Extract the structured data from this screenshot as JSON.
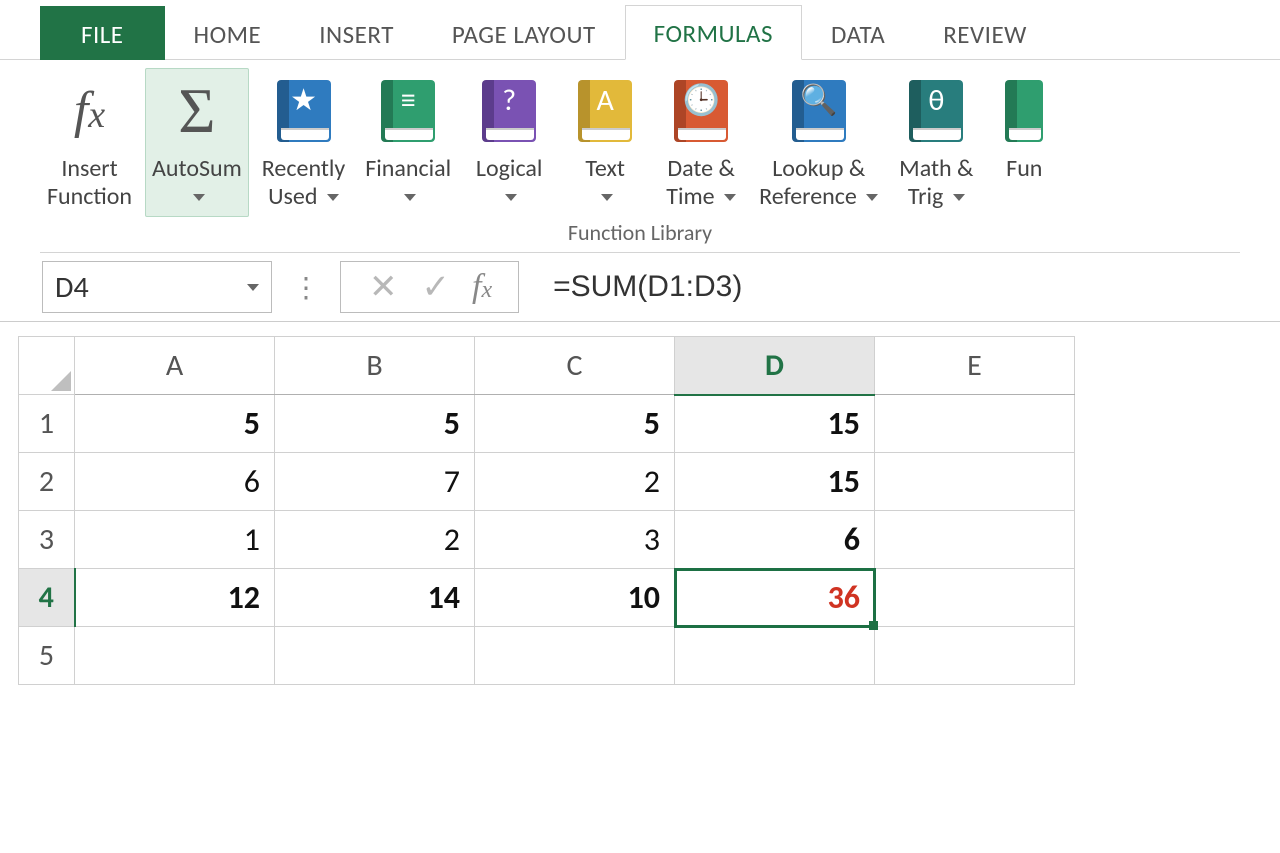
{
  "tabs": {
    "file": "FILE",
    "home": "HOME",
    "insert": "INSERT",
    "page_layout": "PAGE LAYOUT",
    "formulas": "FORMULAS",
    "data": "DATA",
    "review": "REVIEW"
  },
  "ribbon": {
    "insert_function": "Insert\nFunction",
    "autosum": "AutoSum",
    "recently_used": "Recently\nUsed",
    "financial": "Financial",
    "logical": "Logical",
    "text": "Text",
    "date_time": "Date &\nTime",
    "lookup_ref": "Lookup &\nReference",
    "math_trig": "Math &\nTrig",
    "more_fn": "Fun",
    "group_title": "Function Library"
  },
  "namebox": {
    "value": "D4"
  },
  "formula_bar": {
    "value": "=SUM(D1:D3)"
  },
  "sheet": {
    "columns": [
      "A",
      "B",
      "C",
      "D",
      "E"
    ],
    "rows": [
      "1",
      "2",
      "3",
      "4",
      "5"
    ],
    "active_col": "D",
    "active_row": "4",
    "cells": {
      "A1": "5",
      "B1": "5",
      "C1": "5",
      "D1": "15",
      "A2": "6",
      "B2": "7",
      "C2": "2",
      "D2": "15",
      "A3": "1",
      "B3": "2",
      "C3": "3",
      "D3": "6",
      "A4": "12",
      "B4": "14",
      "C4": "10",
      "D4": "36"
    }
  }
}
